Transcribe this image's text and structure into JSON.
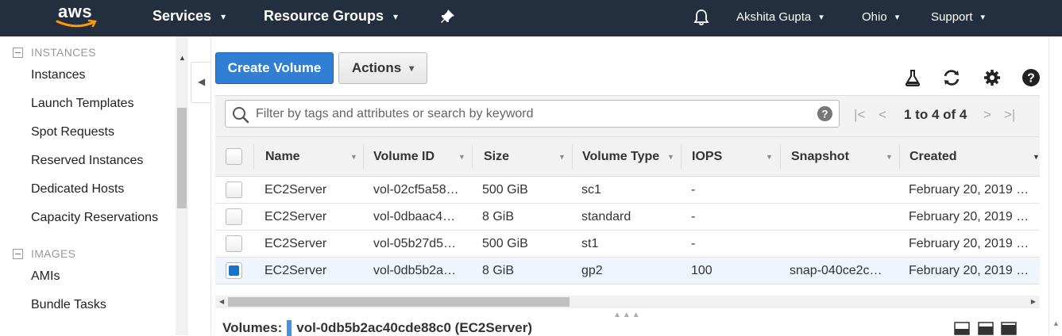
{
  "topnav": {
    "logo": "aws",
    "services": "Services",
    "resource_groups": "Resource Groups",
    "user": "Akshita Gupta",
    "region": "Ohio",
    "support": "Support",
    "chevron": "▾"
  },
  "sidebar": {
    "section_instances": "INSTANCES",
    "items_instances": [
      "Instances",
      "Launch Templates",
      "Spot Requests",
      "Reserved Instances",
      "Dedicated Hosts",
      "Capacity Reservations"
    ],
    "section_images": "IMAGES",
    "items_images": [
      "AMIs",
      "Bundle Tasks"
    ]
  },
  "toolbar": {
    "create_label": "Create Volume",
    "actions_label": "Actions"
  },
  "filter": {
    "placeholder": "Filter by tags and attributes or search by keyword",
    "pagination": "1 to 4 of 4"
  },
  "table": {
    "columns": [
      "Name",
      "Volume ID",
      "Size",
      "Volume Type",
      "IOPS",
      "Snapshot",
      "Created"
    ],
    "rows": [
      {
        "name": "EC2Server",
        "volume_id": "vol-02cf5a58…",
        "size": "500 GiB",
        "type": "sc1",
        "iops": "-",
        "snapshot": "",
        "created": "February 20, 2019 …",
        "selected": false
      },
      {
        "name": "EC2Server",
        "volume_id": "vol-0dbaac4…",
        "size": "8 GiB",
        "type": "standard",
        "iops": "-",
        "snapshot": "",
        "created": "February 20, 2019 …",
        "selected": false
      },
      {
        "name": "EC2Server",
        "volume_id": "vol-05b27d5…",
        "size": "500 GiB",
        "type": "st1",
        "iops": "-",
        "snapshot": "",
        "created": "February 20, 2019 …",
        "selected": false
      },
      {
        "name": "EC2Server",
        "volume_id": "vol-0db5b2a…",
        "size": "8 GiB",
        "type": "gp2",
        "iops": "100",
        "snapshot": "snap-040ce2c…",
        "created": "February 20, 2019 …",
        "selected": true
      }
    ]
  },
  "details": {
    "label": "Volumes:",
    "value": "vol-0db5b2ac40cde88c0 (EC2Server)"
  },
  "colors": {
    "nav_bg": "#232f3e",
    "primary": "#2f7fd5",
    "selected_row": "#eef5fd",
    "aws_orange": "#ff9900"
  },
  "icons": [
    "pin-icon",
    "bell-icon",
    "flask-icon",
    "refresh-icon",
    "gear-icon",
    "help-icon",
    "search-icon"
  ]
}
